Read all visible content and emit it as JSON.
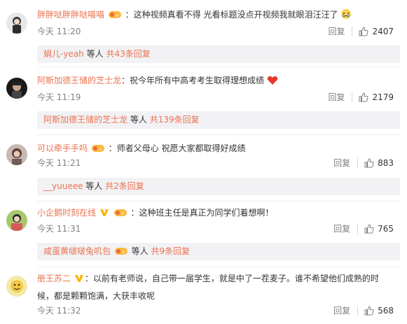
{
  "comments": [
    {
      "username": "胖胖哒胖胖哒喵喵",
      "text": "：这种视频真看不得 光看标题没点开视频我就眼泪汪汪了",
      "time": "今天 11:20",
      "reply_label": "回复",
      "likes": "2407",
      "reply_preview": {
        "user": "娟儿-yeah",
        "suffix": "等人",
        "count_text": "共43条回复"
      }
    },
    {
      "username": "阿斯加德王储的芝士龙",
      "text": "：祝今年所有中高考考生取得理想成绩",
      "time": "今天 11:19",
      "reply_label": "回复",
      "likes": "2179",
      "reply_preview": {
        "user": "阿斯加德王储的芝士龙",
        "suffix": "等人",
        "count_text": "共139条回复"
      }
    },
    {
      "username": "可以牵手手吗",
      "text": "：师者父母心 祝愿大家都取得好成绩",
      "time": "今天 11:21",
      "reply_label": "回复",
      "likes": "883",
      "reply_preview": {
        "user": "__yuueee",
        "suffix": "等人",
        "count_text": "共2条回复"
      }
    },
    {
      "username": "小企鹅时刻在线",
      "text": "：这种班主任是真正为同学们着想啊！",
      "time": "今天 11:31",
      "reply_label": "回复",
      "likes": "765",
      "reply_preview": {
        "user": "咸蛋黄啵啵兔叽包",
        "suffix": "等人",
        "count_text": "共9条回复"
      }
    },
    {
      "username": "册王苏二",
      "text": "：以前有老师说，自己带一届学生，就是中了一茬麦子。谁不希望他们成熟的时候，都是颗颗饱满，大获丰收呢",
      "time": "今天 11:32",
      "reply_label": "回复",
      "likes": "568"
    }
  ],
  "icons": {
    "like": "thumbs-up-icon",
    "badge_vip": "vip-badge-icon",
    "badge_verified": "verified-v-icon",
    "emoji_cry": "crying-emoji-icon",
    "emoji_heart": "heart-emoji-icon"
  },
  "colors": {
    "username": "#eb7350",
    "reply_bar_bg": "#f2f2f5",
    "meta_text": "#808080"
  }
}
